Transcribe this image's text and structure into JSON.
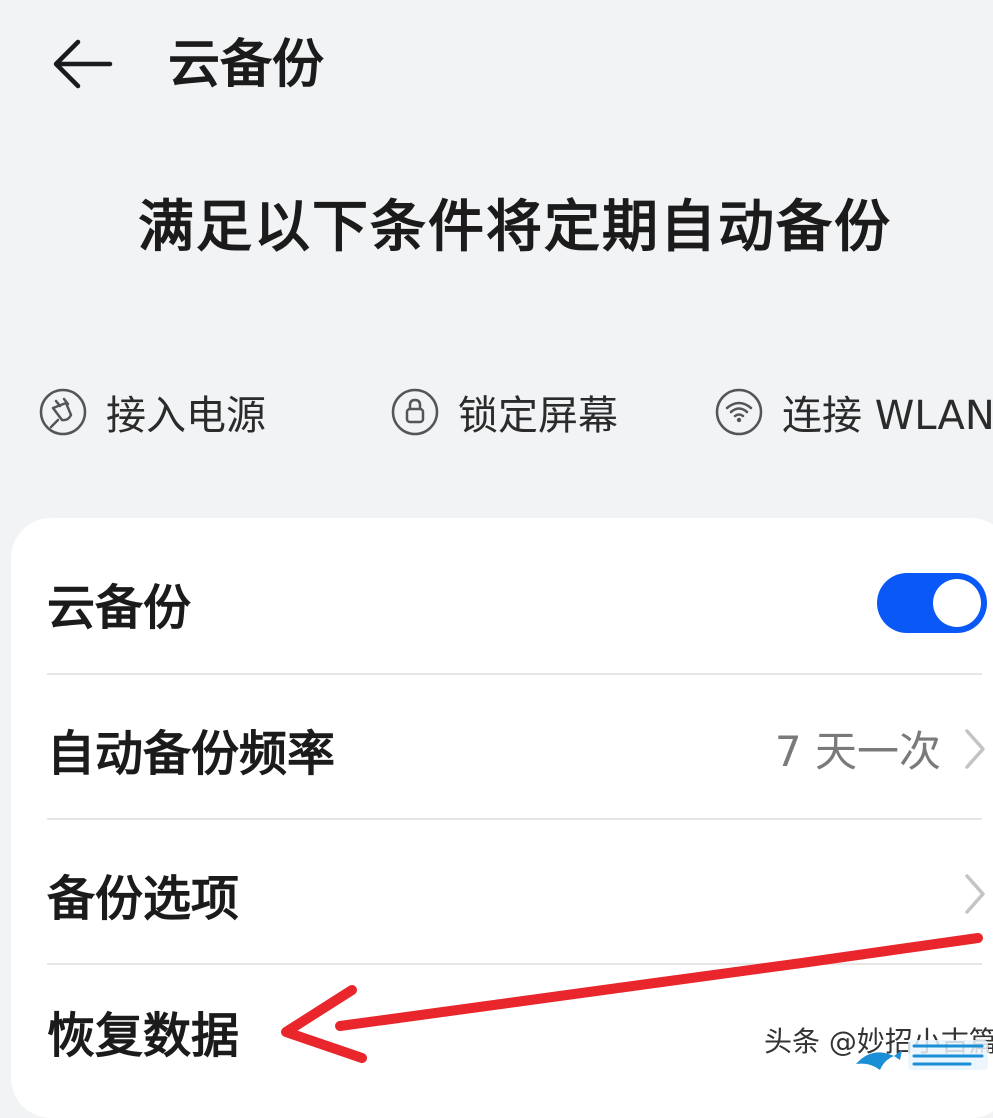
{
  "header": {
    "title": "云备份"
  },
  "subtitle": "满足以下条件将定期自动备份",
  "conditions": [
    {
      "label": "接入电源",
      "icon": "power-plug-icon"
    },
    {
      "label": "锁定屏幕",
      "icon": "lock-icon"
    },
    {
      "label": "连接 WLAN",
      "icon": "wifi-icon"
    }
  ],
  "settings": {
    "cloud_backup": {
      "label": "云备份",
      "enabled": true
    },
    "frequency": {
      "label": "自动备份频率",
      "value": "7 天一次"
    },
    "options": {
      "label": "备份选项"
    },
    "restore": {
      "label": "恢复数据"
    }
  },
  "watermark": "头条 @妙招小古篇",
  "colors": {
    "accent": "#0a59f7",
    "annotation_arrow": "#e8262b",
    "background": "#f1f3f5"
  }
}
